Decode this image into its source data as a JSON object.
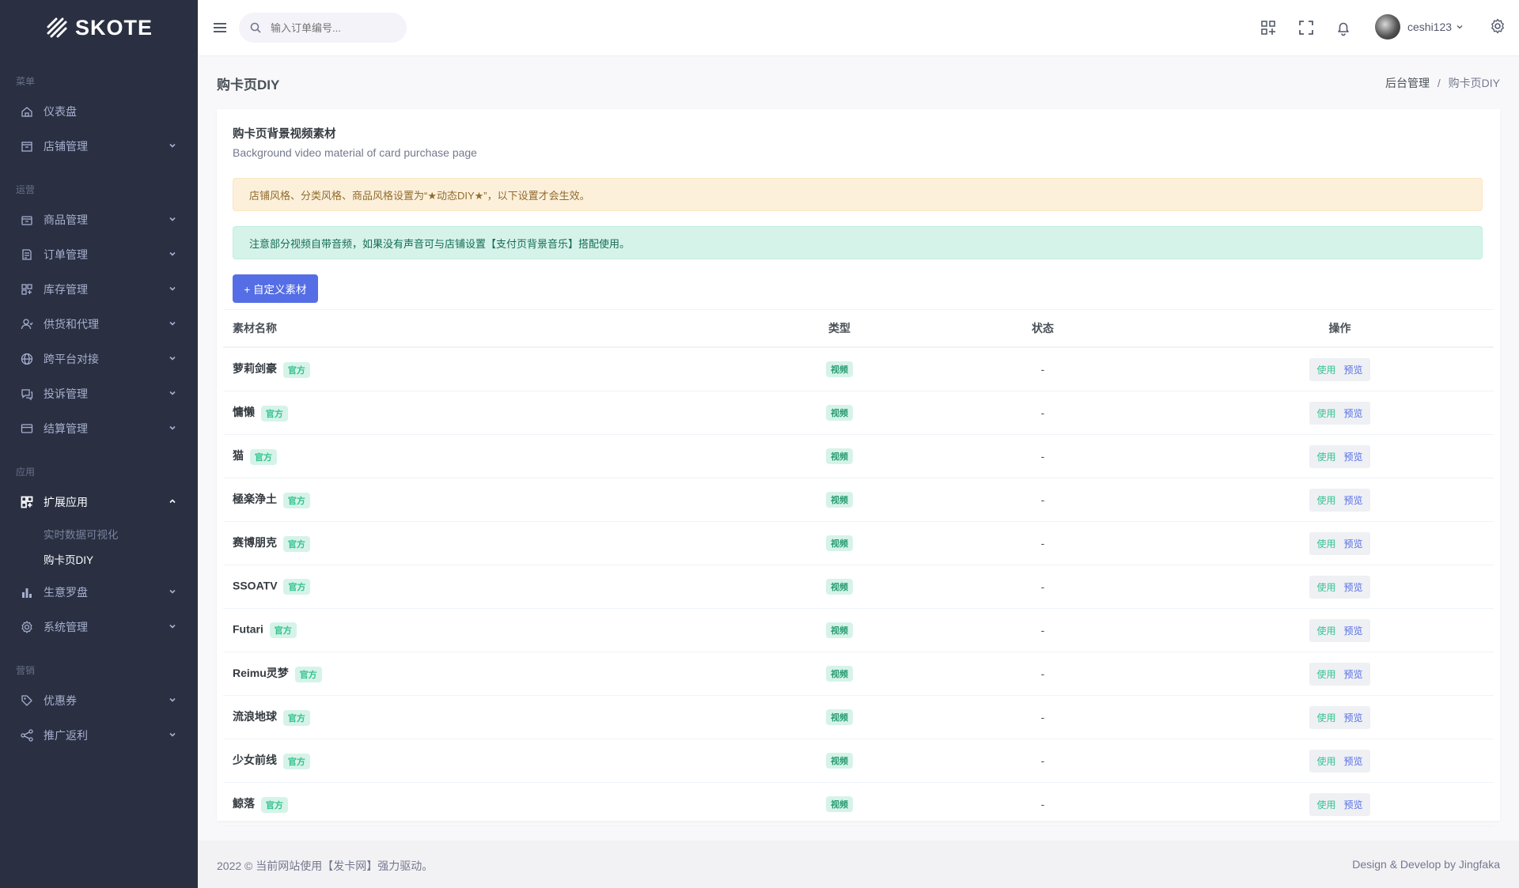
{
  "brand": {
    "name": "SKOTE"
  },
  "sidebar": {
    "sections": [
      {
        "title": "菜单",
        "items": [
          {
            "label": "仪表盘",
            "icon": "home-icon",
            "has_children": false
          },
          {
            "label": "店铺管理",
            "icon": "store-icon",
            "has_children": true
          }
        ]
      },
      {
        "title": "运营",
        "items": [
          {
            "label": "商品管理",
            "icon": "box-icon",
            "has_children": true
          },
          {
            "label": "订单管理",
            "icon": "receipt-icon",
            "has_children": true
          },
          {
            "label": "库存管理",
            "icon": "grid-icon",
            "has_children": true
          },
          {
            "label": "供货和代理",
            "icon": "user-icon",
            "has_children": true
          },
          {
            "label": "跨平台对接",
            "icon": "globe-icon",
            "has_children": true
          },
          {
            "label": "投诉管理",
            "icon": "chat-icon",
            "has_children": true
          },
          {
            "label": "结算管理",
            "icon": "card-icon",
            "has_children": true
          }
        ]
      },
      {
        "title": "应用",
        "items": [
          {
            "label": "扩展应用",
            "icon": "apps-icon",
            "has_children": true,
            "expanded": true,
            "children": [
              {
                "label": "实时数据可视化"
              },
              {
                "label": "购卡页DIY",
                "active": true
              }
            ]
          },
          {
            "label": "生意罗盘",
            "icon": "bar-chart-icon",
            "has_children": true
          },
          {
            "label": "系统管理",
            "icon": "gear-icon",
            "has_children": true
          }
        ]
      },
      {
        "title": "营销",
        "items": [
          {
            "label": "优惠券",
            "icon": "tag-icon",
            "has_children": true
          },
          {
            "label": "推广返利",
            "icon": "share-icon",
            "has_children": true
          }
        ]
      }
    ]
  },
  "topbar": {
    "search_placeholder": "输入订单编号...",
    "username": "ceshi123"
  },
  "page": {
    "title": "购卡页DIY",
    "breadcrumb": [
      "后台管理",
      "购卡页DIY"
    ]
  },
  "card": {
    "title": "购卡页背景视频素材",
    "subtitle": "Background video material of card purchase page",
    "alert_warning": "店铺风格、分类风格、商品风格设置为“★动态DIY★”，以下设置才会生效。",
    "alert_info": "注意部分视频自带音频，如果没有声音可与店铺设置【支付页背景音乐】搭配使用。",
    "add_button": "+ 自定义素材"
  },
  "table": {
    "headers": [
      "素材名称",
      "类型",
      "状态",
      "操作"
    ],
    "rows": [
      {
        "name": "萝莉剑豪",
        "badge": "官方",
        "type": "视频",
        "status": "-",
        "use": "使用",
        "preview": "预览"
      },
      {
        "name": "慵懒",
        "badge": "官方",
        "type": "视频",
        "status": "-",
        "use": "使用",
        "preview": "预览"
      },
      {
        "name": "猫",
        "badge": "官方",
        "type": "视频",
        "status": "-",
        "use": "使用",
        "preview": "预览"
      },
      {
        "name": "極楽浄土",
        "badge": "官方",
        "type": "视频",
        "status": "-",
        "use": "使用",
        "preview": "预览"
      },
      {
        "name": "赛博朋克",
        "badge": "官方",
        "type": "视频",
        "status": "-",
        "use": "使用",
        "preview": "预览"
      },
      {
        "name": "SSOATV",
        "badge": "官方",
        "type": "视频",
        "status": "-",
        "use": "使用",
        "preview": "预览"
      },
      {
        "name": "Futari",
        "badge": "官方",
        "type": "视频",
        "status": "-",
        "use": "使用",
        "preview": "预览"
      },
      {
        "name": "Reimu灵梦",
        "badge": "官方",
        "type": "视频",
        "status": "-",
        "use": "使用",
        "preview": "预览"
      },
      {
        "name": "流浪地球",
        "badge": "官方",
        "type": "视频",
        "status": "-",
        "use": "使用",
        "preview": "预览"
      },
      {
        "name": "少女前线",
        "badge": "官方",
        "type": "视频",
        "status": "-",
        "use": "使用",
        "preview": "预览"
      },
      {
        "name": "鯨落",
        "badge": "官方",
        "type": "视频",
        "status": "-",
        "use": "使用",
        "preview": "预览"
      }
    ]
  },
  "footer": {
    "left": "2022 © 当前网站使用【发卡网】强力驱动。",
    "right": "Design & Develop by Jingfaka"
  },
  "colors": {
    "sidebar_bg": "#2a3042",
    "primary": "#556ee6",
    "success": "#34c38f",
    "warning_bg": "#fcf0db",
    "info_bg": "#d6f3e9"
  }
}
